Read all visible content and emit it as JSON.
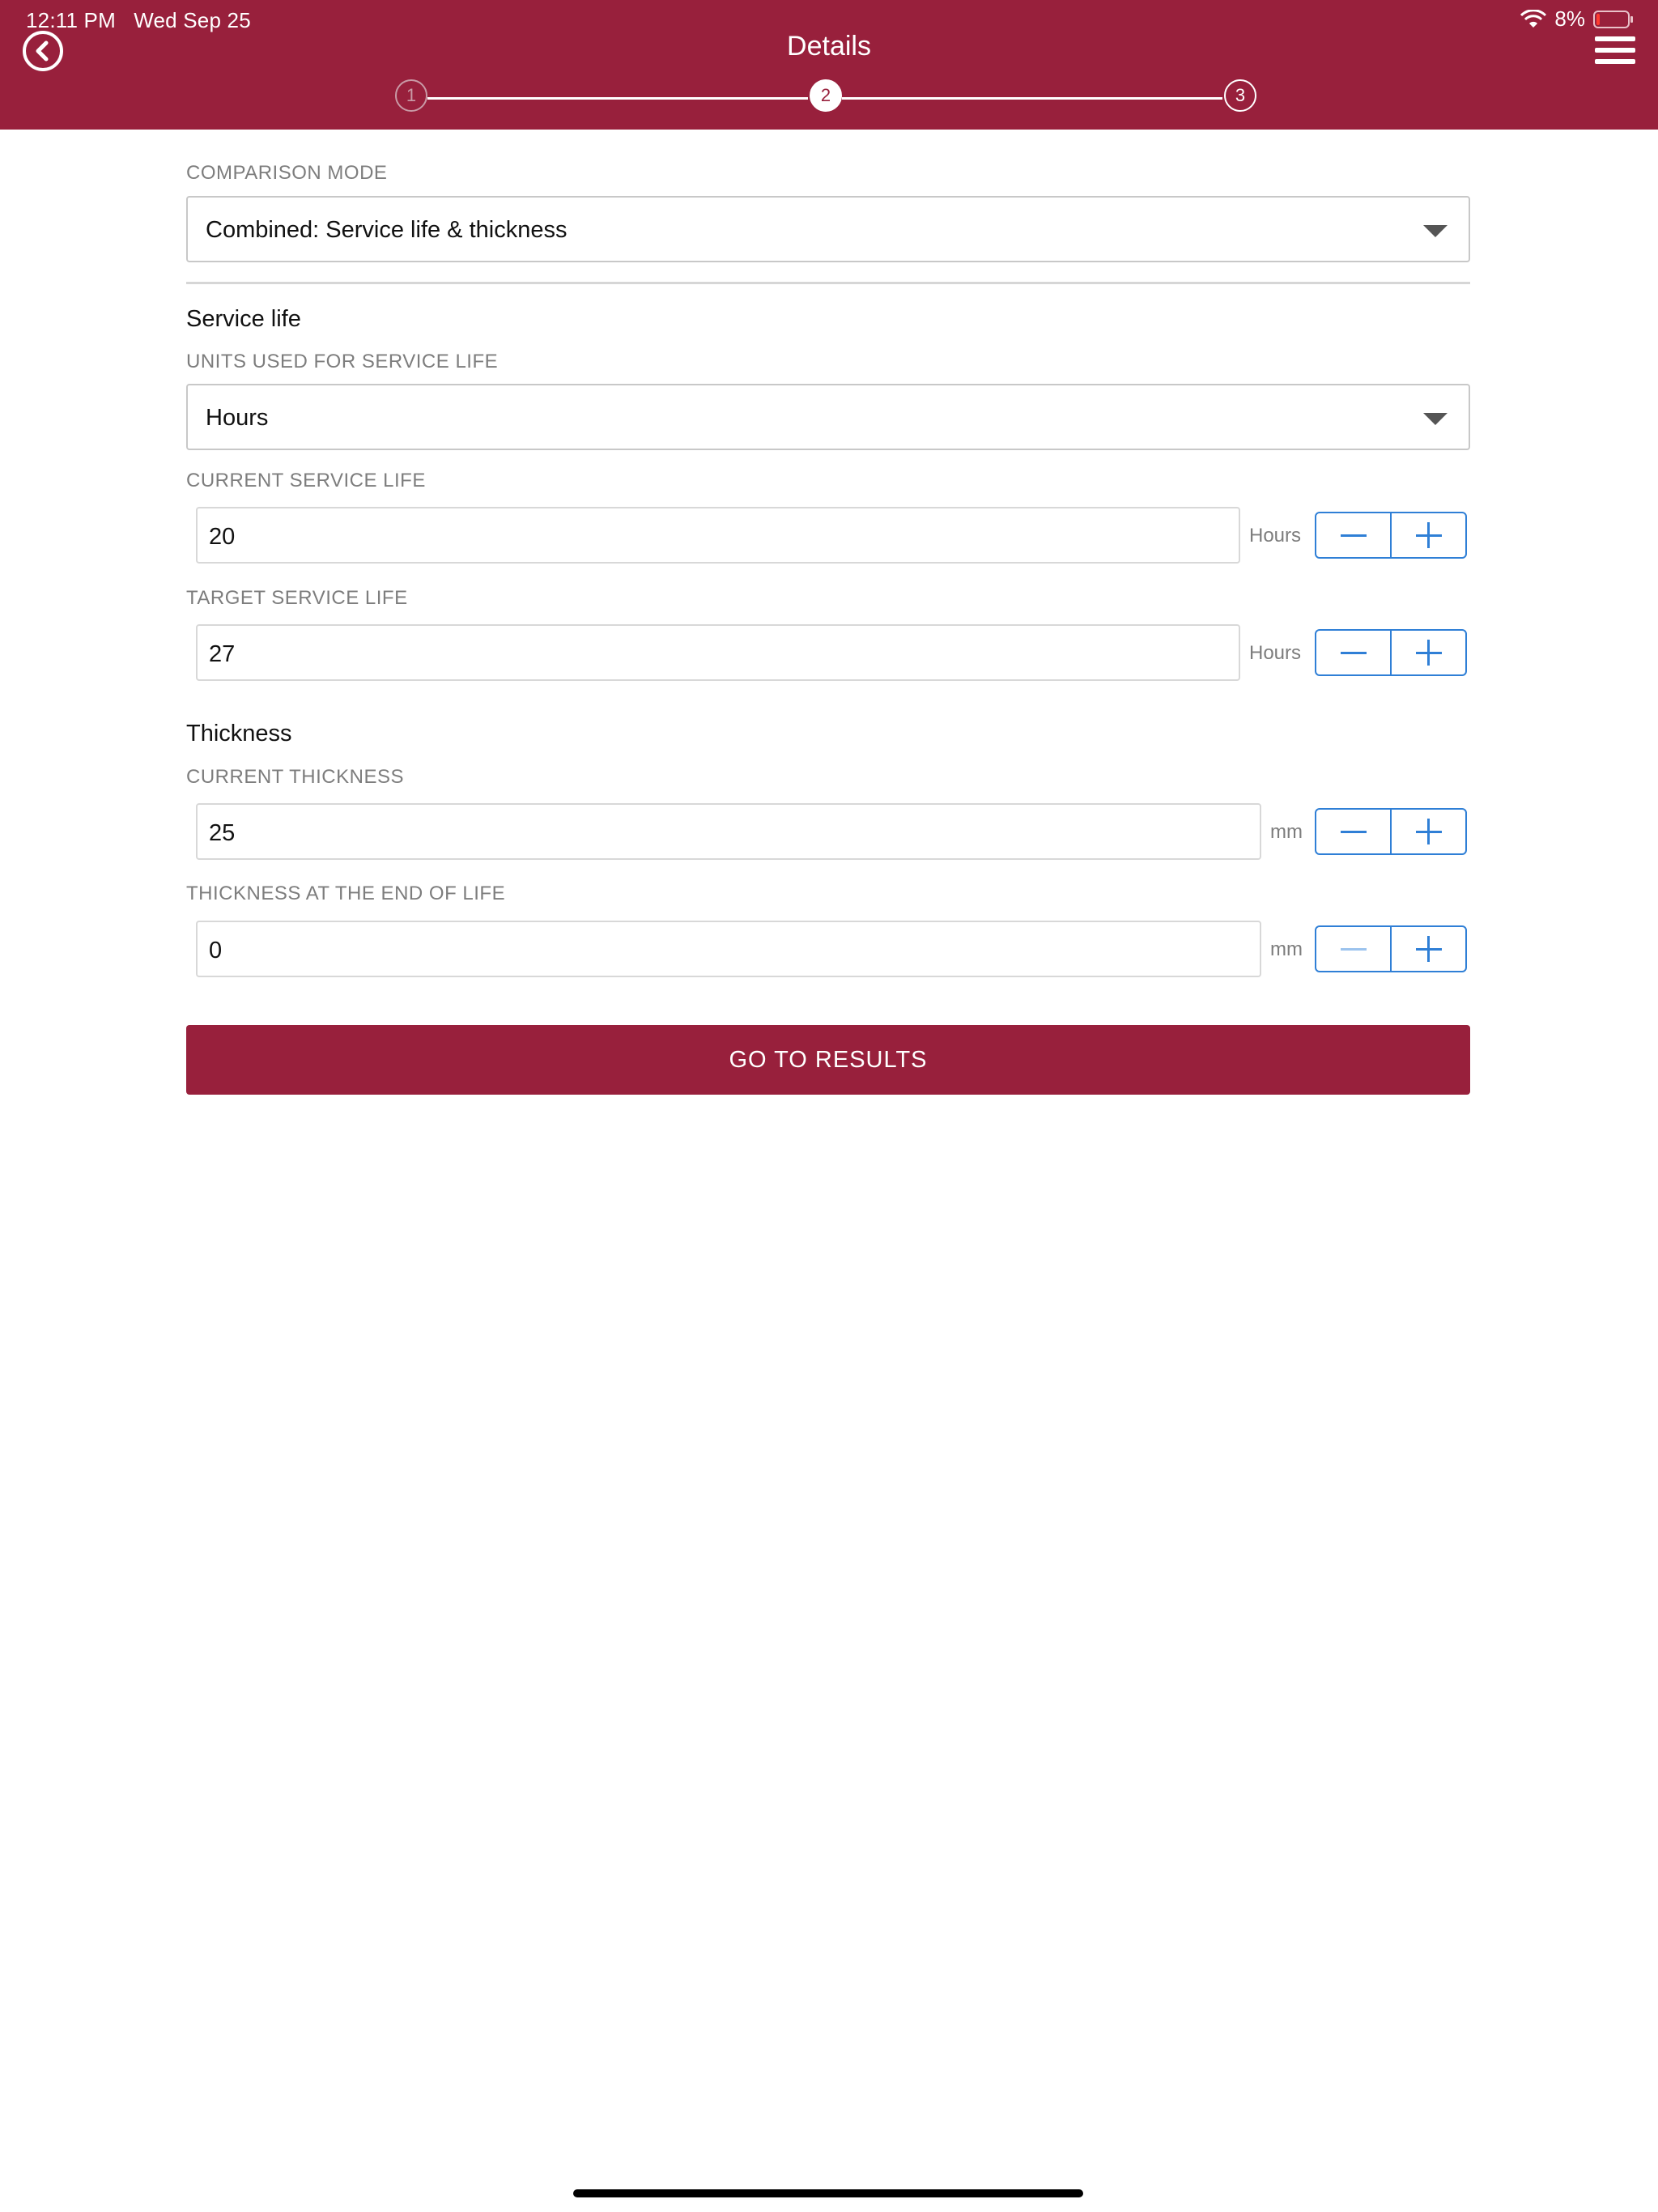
{
  "status_bar": {
    "time": "12:11 PM",
    "date": "Wed Sep 25",
    "battery": "8%"
  },
  "header": {
    "title": "Details",
    "back_icon": "back-circle-icon",
    "menu_icon": "hamburger-menu-icon",
    "accent_color": "#98203c"
  },
  "stepper": {
    "steps": [
      "1",
      "2",
      "3"
    ],
    "current": "2"
  },
  "comparison_mode": {
    "label": "COMPARISON MODE",
    "value": "Combined: Service life & thickness"
  },
  "service_life": {
    "title": "Service life",
    "units_label": "UNITS USED FOR SERVICE LIFE",
    "units_value": "Hours",
    "current_label": "CURRENT SERVICE LIFE",
    "current_value": "20",
    "current_unit": "Hours",
    "target_label": "TARGET SERVICE LIFE",
    "target_value": "27",
    "target_unit": "Hours"
  },
  "thickness": {
    "title": "Thickness",
    "current_label": "CURRENT THICKNESS",
    "current_value": "25",
    "current_unit": "mm",
    "end_label": "THICKNESS AT THE END OF LIFE",
    "end_value": "0",
    "end_unit": "mm"
  },
  "actions": {
    "go_to_results": "GO TO RESULTS"
  }
}
